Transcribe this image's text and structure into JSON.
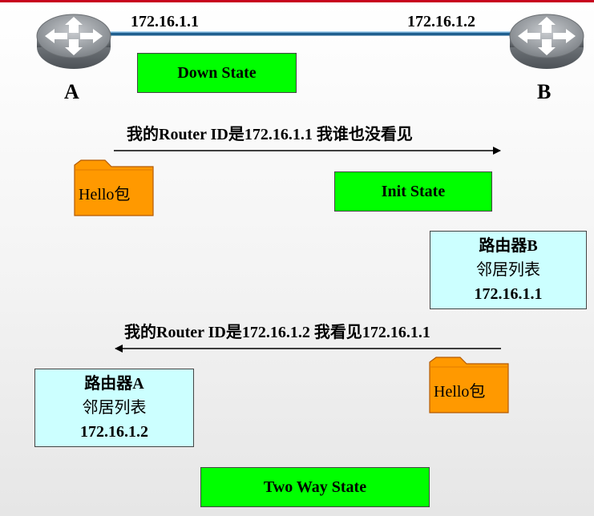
{
  "routers": {
    "a": {
      "name": "A",
      "ip": "172.16.1.1"
    },
    "b": {
      "name": "B",
      "ip": "172.16.1.2"
    }
  },
  "states": {
    "down": "Down State",
    "init": "Init State",
    "two_way": "Two Way State"
  },
  "messages": {
    "a_to_b": "我的Router ID是172.16.1.1 我谁也没看见",
    "b_to_a": "我的Router ID是172.16.1.2 我看见172.16.1.1"
  },
  "packets": {
    "hello_1": "Hello包",
    "hello_2": "Hello包"
  },
  "neighbor_tables": {
    "b": {
      "title": "路由器B",
      "subtitle": "邻居列表",
      "entry": "172.16.1.1"
    },
    "a": {
      "title": "路由器A",
      "subtitle": "邻居列表",
      "entry": "172.16.1.2"
    }
  },
  "colors": {
    "state_fill": "#00ff00",
    "table_fill": "#ccffff",
    "packet_fill": "#ff9900",
    "link": "#1f5f8f",
    "accent_bar": "#c8001e"
  }
}
